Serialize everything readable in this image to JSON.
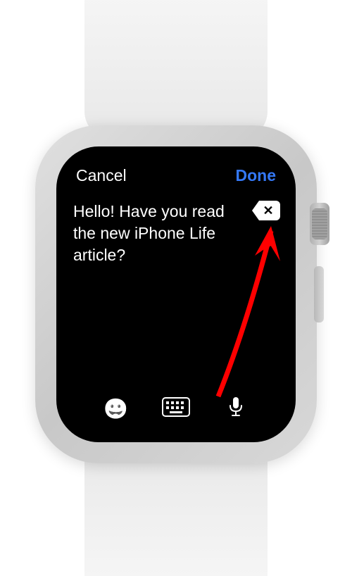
{
  "header": {
    "cancel_label": "Cancel",
    "done_label": "Done"
  },
  "compose": {
    "text": "Hello! Have you read the new iPhone Life article?"
  },
  "toolbar": {
    "emoji_label": "emoji",
    "keyboard_label": "keyboard",
    "mic_label": "voice-input"
  },
  "annotation": {
    "target": "done-button",
    "color": "#ff0000"
  }
}
